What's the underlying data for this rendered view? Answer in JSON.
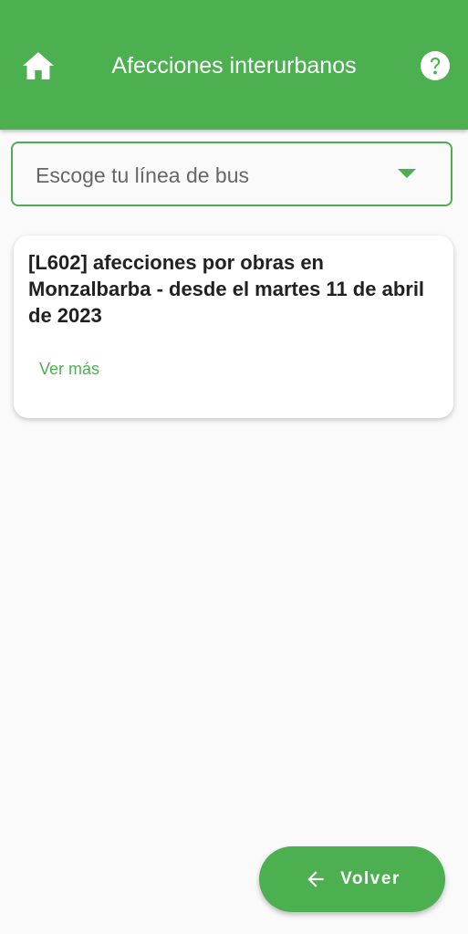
{
  "header": {
    "title": "Afecciones interurbanos",
    "home_icon": "home-icon",
    "help_icon": "help-icon",
    "bg_color": "#4caf50"
  },
  "line_select": {
    "placeholder": "Escoge tu línea de bus",
    "icon": "dropdown-caret-icon"
  },
  "notices": [
    {
      "title": "[L602] afecciones por obras en Monzalbarba - desde el martes 11 de abril de 2023",
      "link_label": "Ver más"
    }
  ],
  "back_button": {
    "label": "Volver",
    "icon": "arrow-left-icon"
  }
}
